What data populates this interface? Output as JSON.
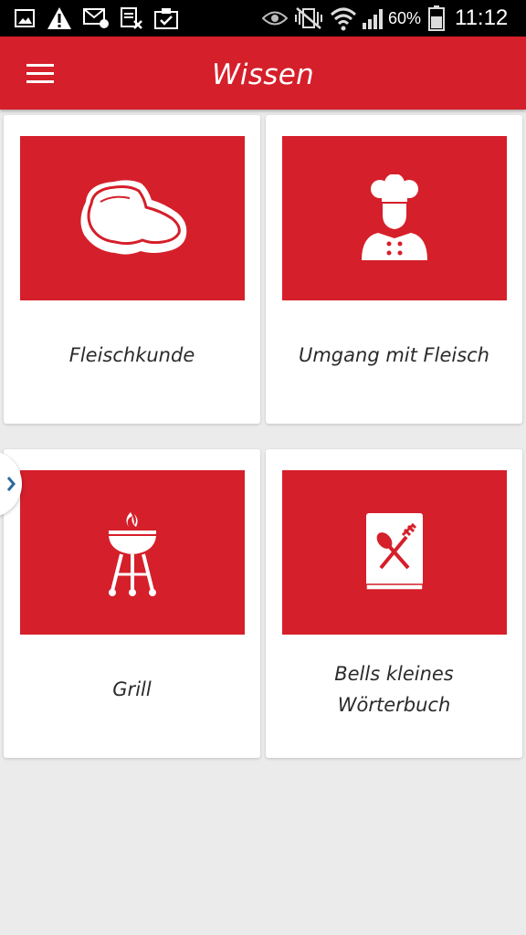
{
  "status_bar": {
    "battery": "60%",
    "time": "11:12",
    "icons": [
      "image-icon",
      "warning-icon",
      "mail-icon",
      "clipboard-x-icon",
      "clipboard-check-icon",
      "eye-icon",
      "vibrate-icon",
      "wifi-icon",
      "signal-icon",
      "battery-icon"
    ]
  },
  "appbar": {
    "title": "Wissen",
    "menu_icon": "hamburger-menu-icon",
    "color": "#d51f2a"
  },
  "cards": [
    {
      "label": "Fleischkunde",
      "icon": "steak-icon"
    },
    {
      "label": "Umgang mit Fleisch",
      "icon": "chef-icon"
    },
    {
      "label": "Grill",
      "icon": "grill-icon"
    },
    {
      "label_line1": "Bells kleines",
      "label_line2": "Wörterbuch",
      "icon": "cookbook-icon"
    }
  ],
  "side_tab": {
    "icon": "chevron-right-icon"
  }
}
